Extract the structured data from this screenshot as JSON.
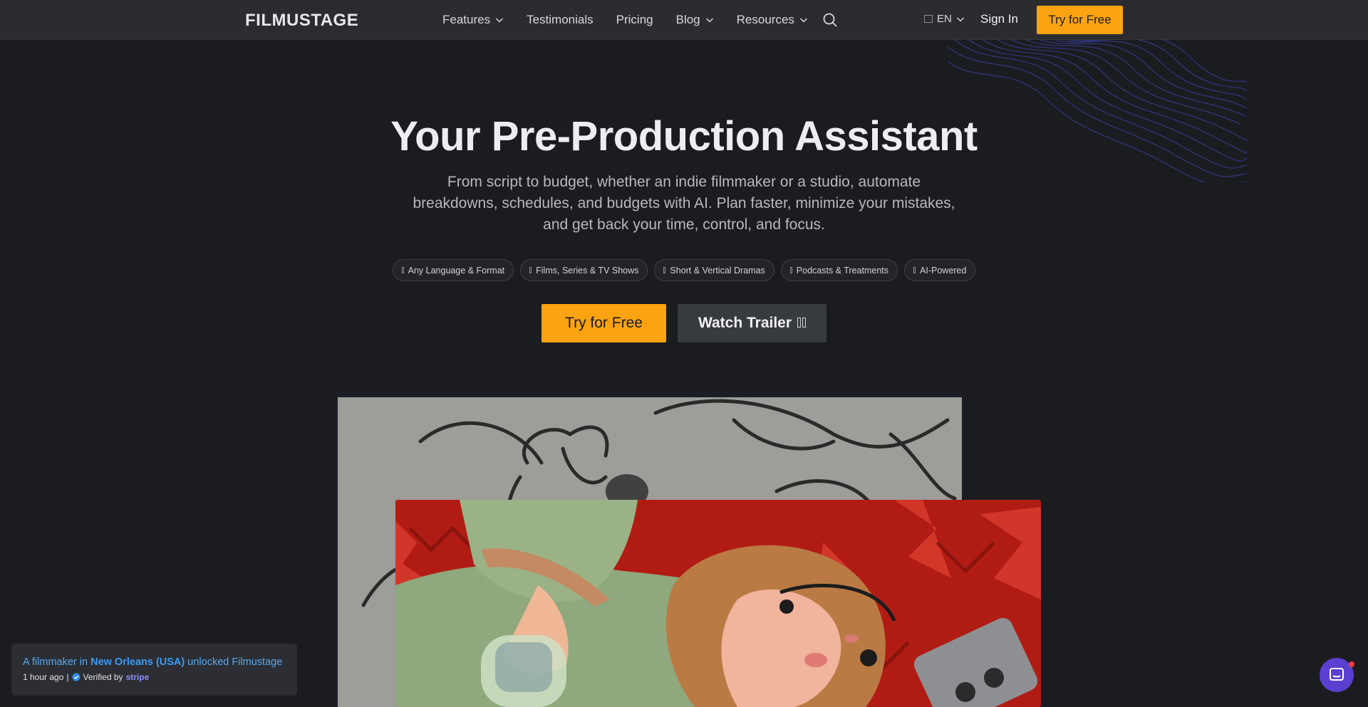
{
  "nav": {
    "logo": "FILMUSTAGE",
    "items": [
      {
        "label": "Features",
        "dropdown": true
      },
      {
        "label": "Testimonials",
        "dropdown": false
      },
      {
        "label": "Pricing",
        "dropdown": false
      },
      {
        "label": "Blog",
        "dropdown": true
      },
      {
        "label": "Resources",
        "dropdown": true
      }
    ],
    "search_icon": "search-icon",
    "language": "EN",
    "sign_in": "Sign In",
    "cta": "Try for Free"
  },
  "hero": {
    "title": "Your Pre-Production Assistant",
    "subtitle": "From script to budget, whether an indie filmmaker or a studio, automate breakdowns, schedules, and budgets with AI. Plan faster, minimize your mistakes, and get back your time, control, and focus.",
    "chips": [
      "Any Language & Format",
      "Films, Series & TV Shows",
      "Short & Vertical Dramas",
      "Podcasts & Treatments",
      "AI-Powered"
    ],
    "primary_cta": "Try for Free",
    "secondary_cta": "Watch Trailer"
  },
  "toast": {
    "prefix": "A filmmaker in ",
    "location": "New Orleans (USA)",
    "suffix": " unlocked Filmustage",
    "time": "1 hour ago",
    "verified": "Verified by",
    "provider": "stripe"
  },
  "colors": {
    "accent": "#fca311",
    "background": "#1b1c1f",
    "nav": "#2a2c30",
    "chat": "#5b3fd1"
  }
}
